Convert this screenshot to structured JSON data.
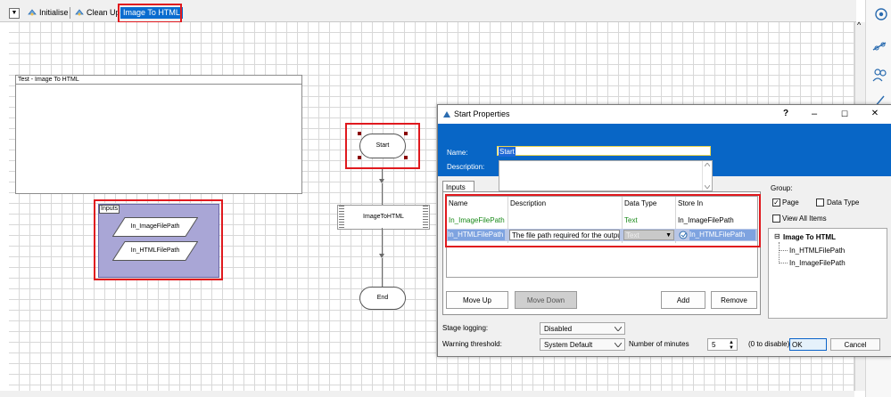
{
  "tabs": {
    "items": [
      {
        "label": "Initialise"
      },
      {
        "label": "Clean Up"
      },
      {
        "label": "Image To HTML"
      }
    ]
  },
  "canvas": {
    "page_block_title": "Test - Image To HTML",
    "inputs_group_label": "Inputs",
    "inputs_group_items": [
      "In_ImageFilePath",
      "In_HTMLFilePath"
    ],
    "start_label": "Start",
    "action_label": "ImageToHTML",
    "end_label": "End",
    "scroll_up_glyph": "^"
  },
  "dialog": {
    "title": "Start Properties",
    "controls": {
      "help": "?",
      "minimize": "–",
      "maximize": "☐",
      "close": "✕"
    },
    "name_label": "Name:",
    "name_value": "Start",
    "description_label": "Description:",
    "description_value": "",
    "inputs_tab_label": "Inputs",
    "grid": {
      "headers": [
        "Name",
        "Description",
        "Data Type",
        "Store In"
      ],
      "rows": [
        {
          "name": "In_ImageFilePath",
          "description": "",
          "data_type": "Text",
          "store_in": "In_ImageFilePath"
        },
        {
          "name": "In_HTMLFilePath",
          "description": "The file path required for the output h",
          "data_type": "Text",
          "store_in": "In_HTMLFilePath"
        }
      ]
    },
    "buttons": {
      "move_up": "Move Up",
      "move_down": "Move Down",
      "add": "Add",
      "remove": "Remove",
      "ok": "OK",
      "cancel": "Cancel"
    },
    "group": {
      "label": "Group:",
      "page_label": "Page",
      "page_checked": true,
      "data_type_label": "Data Type",
      "data_type_checked": false,
      "view_all_label": "View All Items",
      "view_all_checked": false,
      "tree_root": "Image To HTML",
      "tree_children": [
        "In_HTMLFilePath",
        "In_ImageFilePath"
      ],
      "tree_expander": "⊟"
    },
    "stage_logging_label": "Stage logging:",
    "stage_logging_value": "Disabled",
    "warning_threshold_label": "Warning threshold:",
    "warning_threshold_value": "System Default",
    "number_of_minutes_label": "Number of minutes",
    "minutes_value": "5",
    "disable_hint": "(0 to disable)"
  },
  "colors": {
    "accent": "#0866c6",
    "highlight_box": "#e0191e",
    "group_fill": "#a9a6d6",
    "name_green": "#1a8a1a"
  }
}
